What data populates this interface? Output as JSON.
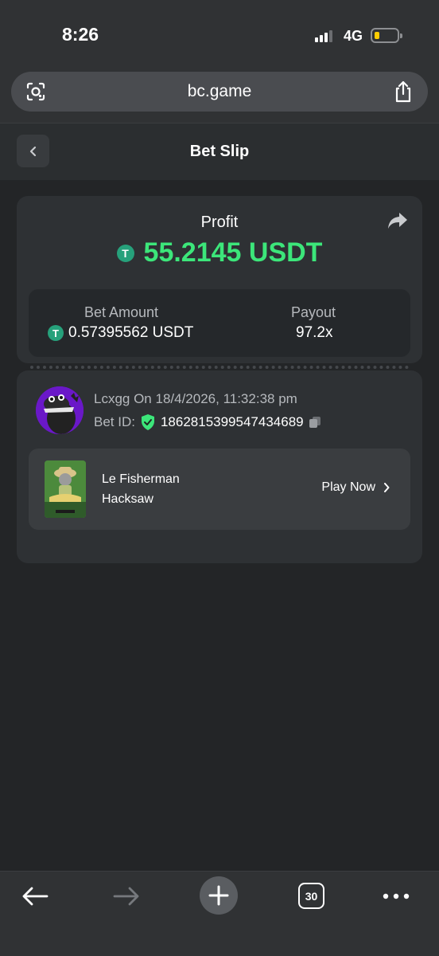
{
  "status_bar": {
    "time": "8:26",
    "network": "4G",
    "battery_level": 0.15,
    "signal_bars": 3
  },
  "browser": {
    "url": "bc.game",
    "tab_count": "30",
    "icons": [
      "lens-icon",
      "share-icon",
      "back-arrow-icon",
      "forward-arrow-icon",
      "plus-icon",
      "tabs-icon",
      "more-icon"
    ]
  },
  "header": {
    "title": "Bet Slip",
    "back_icon": "chevron-left-icon"
  },
  "profit_card": {
    "profit_label": "Profit",
    "profit_value": "55.2145 USDT",
    "coin_glyph": "T",
    "bet_amount_label": "Bet Amount",
    "bet_amount_value": "0.57395562 USDT",
    "payout_label": "Payout",
    "payout_value": "97.2x"
  },
  "bet_details": {
    "user_line": "Lcxgg On 18/4/2026, 11:32:38 pm",
    "bet_id_label": "Bet ID:",
    "bet_id_value": "1862815399547434689",
    "game": {
      "name": "Le Fisherman",
      "provider": "Hacksaw",
      "play_label": "Play Now"
    }
  },
  "colors": {
    "profit_green": "#3ce67a",
    "usdt_green": "#26a17b",
    "avatar_purple": "#6a18c8"
  }
}
